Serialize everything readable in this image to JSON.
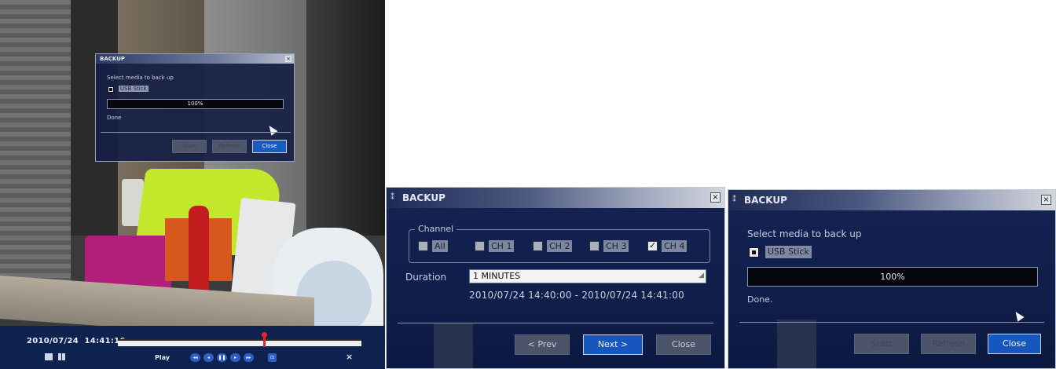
{
  "camera_view": {
    "backup_dialog": {
      "title": "BACKUP",
      "close_glyph": "×",
      "select_media_label": "Select media to back up",
      "usb_stick_label": "USB Stick",
      "usb_stick_checked": true,
      "progress_text": "100%",
      "progress_fraction": 1.0,
      "status_text": "Done",
      "buttons": {
        "start": "Start",
        "refresh": "Refresh",
        "close": "Close"
      }
    },
    "playback_bar": {
      "date": "2010/07/24",
      "time": "14:41:16",
      "play_label": "Play",
      "timeline_position_fraction": 0.6,
      "close_glyph": "×",
      "controls": [
        "fast-rewind",
        "step-back",
        "pause",
        "step-forward",
        "fast-forward",
        "repeat"
      ],
      "control_glyphs": [
        "◂◂",
        "◂",
        "❚❚",
        "▸",
        "▸▸",
        "⊡"
      ]
    }
  },
  "channel_dialog": {
    "title": "BACKUP",
    "close_glyph": "×",
    "channel_legend": "Channel",
    "channels": [
      {
        "label": "All",
        "checked": false
      },
      {
        "label": "CH 1",
        "checked": false
      },
      {
        "label": "CH 2",
        "checked": false
      },
      {
        "label": "CH 3",
        "checked": false
      },
      {
        "label": "CH 4",
        "checked": true
      }
    ],
    "duration_label": "Duration",
    "duration_value": "1 MINUTES",
    "time_range": "2010/07/24 14:40:00 - 2010/07/24 14:41:00",
    "buttons": {
      "prev": "< Prev",
      "next": "Next >",
      "close": "Close"
    }
  },
  "media_dialog": {
    "title": "BACKUP",
    "close_glyph": "×",
    "select_media_label": "Select media to back up",
    "usb_stick_label": "USB Stick",
    "usb_stick_checked": true,
    "progress_text": "100%",
    "progress_fraction": 1.0,
    "status_text": "Done.",
    "buttons": {
      "start": "Start",
      "refresh": "Refresh",
      "close": "Close"
    }
  },
  "colors": {
    "dialog_bg": "#13214f",
    "button_active": "#1757bd",
    "playbar_bg": "#0e2250",
    "timeline_marker": "#e8221c"
  }
}
